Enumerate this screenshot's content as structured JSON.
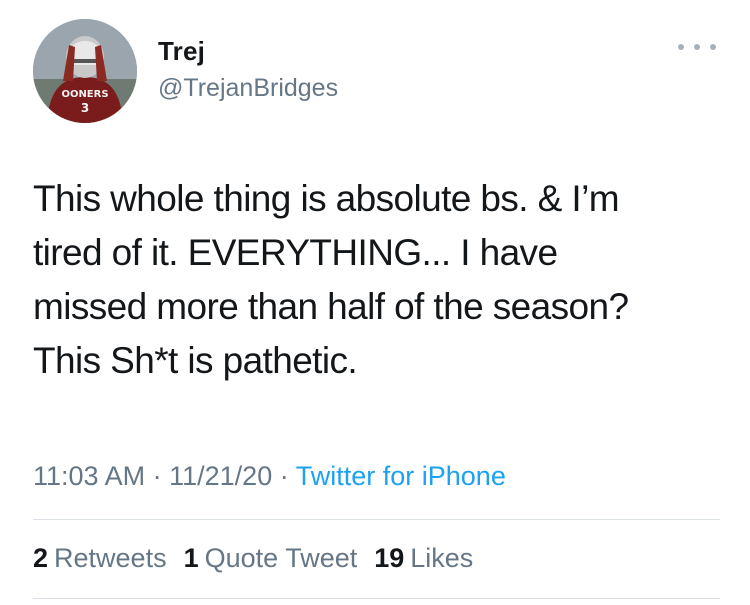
{
  "author": {
    "display_name": "Trej",
    "handle": "@TrejanBridges",
    "avatar_jersey_text": "OONERS",
    "avatar_number": "3"
  },
  "tweet": {
    "text_lines": [
      "This whole thing is absolute bs. & I’m",
      "tired of it. EVERYTHING... I have",
      "missed more than half of the season?",
      "This Sh*t is pathetic."
    ],
    "time": "11:03 AM",
    "separator": "·",
    "date": "11/21/20",
    "source": "Twitter for iPhone"
  },
  "stats": {
    "retweets_count": "2",
    "retweets_label": "Retweets",
    "quotes_count": "1",
    "quotes_label": "Quote Tweet",
    "likes_count": "19",
    "likes_label": "Likes"
  },
  "icons": {
    "more": "more-options-icon"
  },
  "colors": {
    "text": "#14171a",
    "secondary": "#657786",
    "link": "#1da1f2",
    "divider": "#dbe1e6"
  }
}
